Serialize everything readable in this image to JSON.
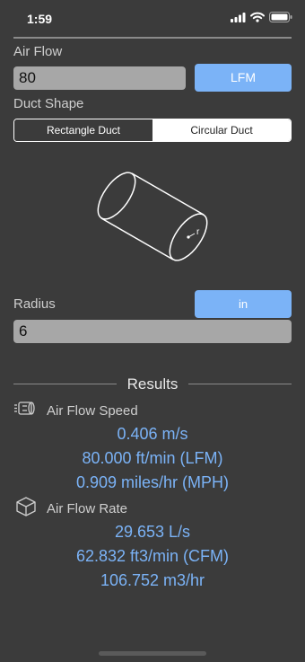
{
  "status": {
    "time": "1:59"
  },
  "airflow": {
    "label": "Air Flow",
    "value": "80",
    "unit_label": "LFM"
  },
  "duct_shape": {
    "label": "Duct Shape",
    "options": [
      {
        "label": "Rectangle Duct",
        "selected": true
      },
      {
        "label": "Circular Duct",
        "selected": false
      }
    ],
    "figure_label": "r"
  },
  "radius": {
    "label": "Radius",
    "value": "6",
    "unit_label": "in"
  },
  "results": {
    "title": "Results",
    "speed": {
      "title": "Air Flow Speed",
      "icon": "duct-speed-icon",
      "lines": [
        "0.406 m/s",
        "80.000 ft/min (LFM)",
        "0.909 miles/hr (MPH)"
      ]
    },
    "rate": {
      "title": "Air Flow Rate",
      "icon": "cube-icon",
      "lines": [
        "29.653 L/s",
        "62.832 ft3/min (CFM)",
        "106.752 m3/hr"
      ]
    }
  },
  "colors": {
    "accent": "#7bb3f7",
    "background": "#3b3b3b",
    "field": "#a7a7a7"
  }
}
